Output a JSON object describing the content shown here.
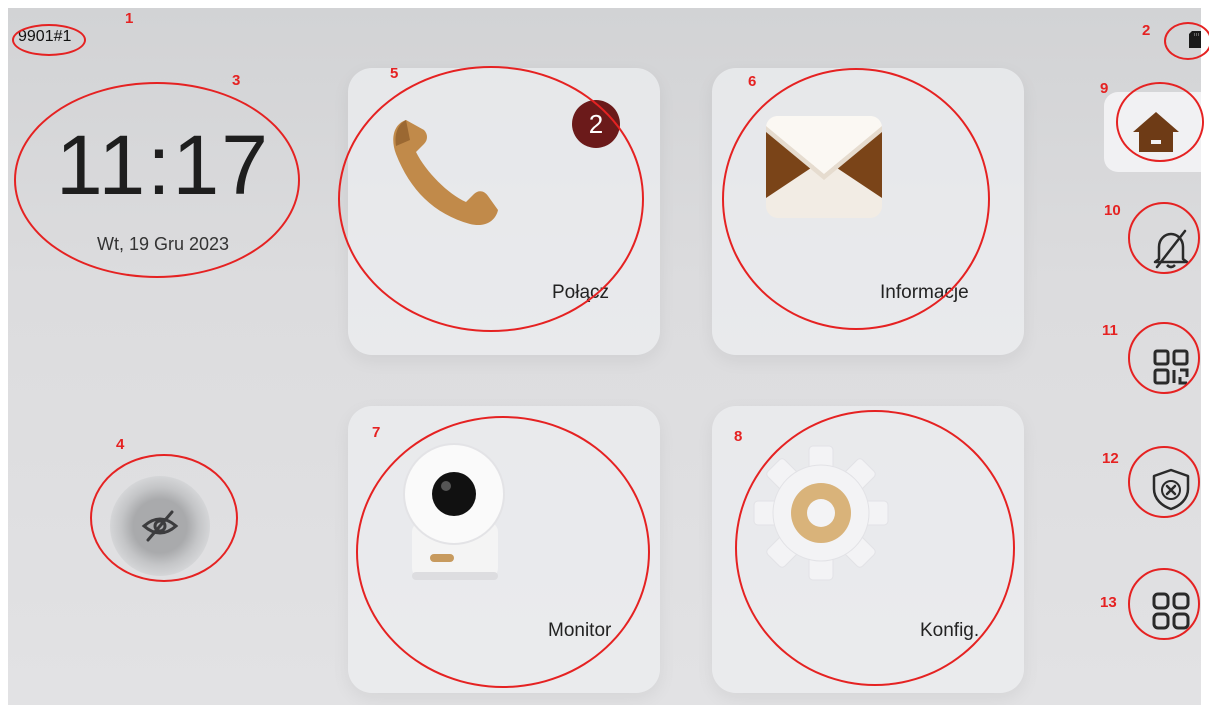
{
  "status_bar": {
    "device_id": "9901#1",
    "storage_icon": "sd-card-icon"
  },
  "clock": {
    "time": "11:17",
    "date": "Wt, 19 Gru 2023"
  },
  "privacy": {
    "icon": "eye-off-icon"
  },
  "tiles": [
    {
      "label": "Połącz",
      "icon": "phone-icon",
      "badge": "2"
    },
    {
      "label": "Informacje",
      "icon": "envelope-icon"
    },
    {
      "label": "Monitor",
      "icon": "camera-icon"
    },
    {
      "label": "Konfig.",
      "icon": "gear-icon"
    }
  ],
  "sidebar": [
    {
      "icon": "home-icon",
      "selected": true
    },
    {
      "icon": "bell-off-icon"
    },
    {
      "icon": "qr-code-icon"
    },
    {
      "icon": "shield-x-icon"
    },
    {
      "icon": "apps-grid-icon"
    }
  ],
  "annotations": [
    "1",
    "2",
    "3",
    "4",
    "5",
    "6",
    "7",
    "8",
    "9",
    "10",
    "11",
    "12",
    "13"
  ],
  "colors": {
    "annotation": "#e52222",
    "badge": "#6b1a1a",
    "accent_brown": "#6e3b16",
    "tan": "#c79a5e"
  }
}
